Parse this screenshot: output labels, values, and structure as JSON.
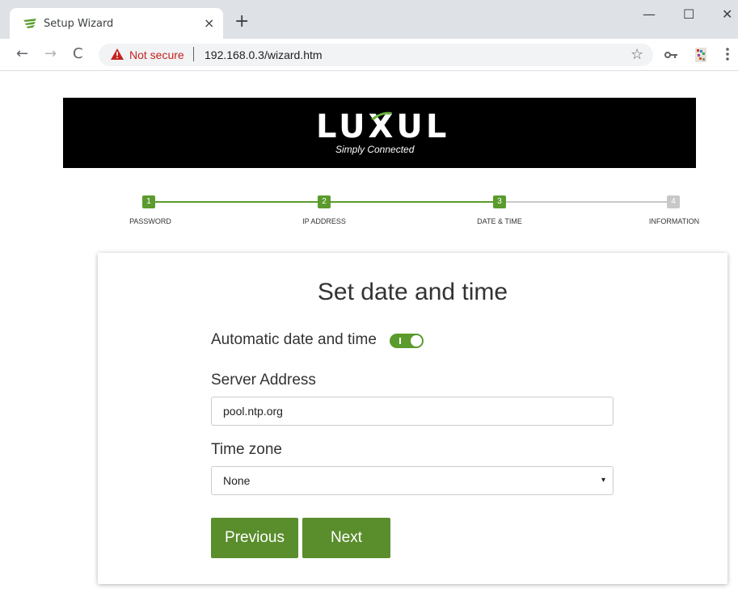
{
  "browser": {
    "tab_title": "Setup Wizard",
    "tab_close": "×",
    "new_tab": "+",
    "minimize": "—",
    "maximize": "☐",
    "close": "✕",
    "back": "←",
    "forward": "→",
    "reload": "C",
    "security_text": "Not secure",
    "url": "192.168.0.3/wizard.htm",
    "bookmark_icon": "☆",
    "icons": [
      "luxul-favicon",
      "warning-icon",
      "star-icon",
      "key-icon",
      "extension-icon",
      "kebab-menu-icon"
    ]
  },
  "banner": {
    "logo_text": "LUXUL",
    "tagline": "Simply Connected"
  },
  "stepper": {
    "current_step": 3,
    "steps": [
      {
        "number": "1",
        "label": "PASSWORD"
      },
      {
        "number": "2",
        "label": "IP ADDRESS"
      },
      {
        "number": "3",
        "label": "DATE & TIME"
      },
      {
        "number": "4",
        "label": "INFORMATION"
      }
    ]
  },
  "form": {
    "title": "Set date and time",
    "auto_label": "Automatic date and time",
    "auto_enabled": true,
    "server_label": "Server Address",
    "server_value": "pool.ntp.org",
    "timezone_label": "Time zone",
    "timezone_value": "None",
    "select_arrow": "▾",
    "previous_label": "Previous",
    "next_label": "Next"
  },
  "colors": {
    "accent_green": "#5a8d2c",
    "step_active": "#5b9b2d",
    "step_inactive": "#c8c8c8",
    "warning_red": "#c5221f"
  }
}
